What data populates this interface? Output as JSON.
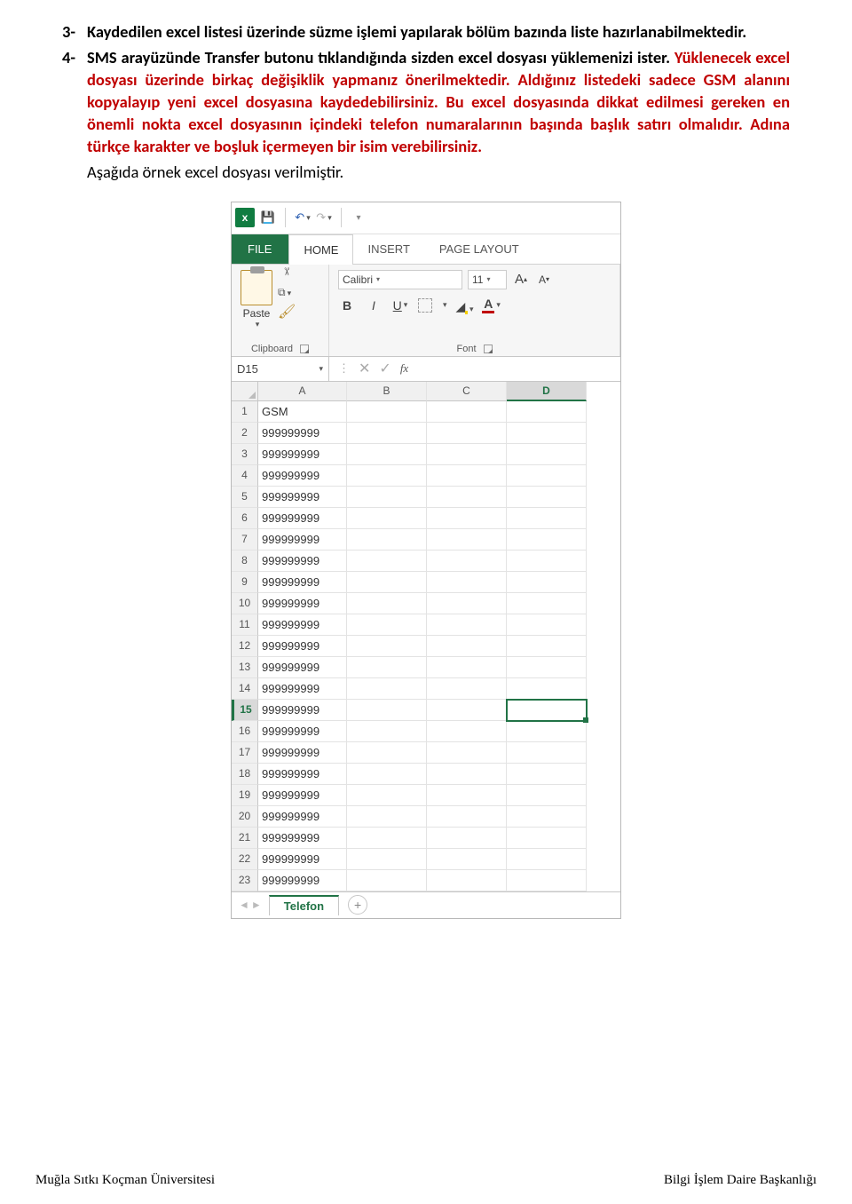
{
  "doc": {
    "item3_num": "3-",
    "item3_text": "Kaydedilen excel listesi üzerinde süzme işlemi yapılarak bölüm bazında liste hazırlanabilmektedir.",
    "item4_num": "4-",
    "item4_lead": "SMS arayüzünde Transfer butonu tıklandığında sizden excel dosyası yüklemenizi ister. ",
    "item4_red1": "Yüklenecek excel dosyası üzerinde birkaç değişiklik yapmanız önerilmektedir. Aldığınız listedeki sadece GSM alanını kopyalayıp yeni excel dosyasına kaydedebilirsiniz. Bu excel dosyasında dikkat edilmesi gereken en önemli nokta excel dosyasının içindeki telefon numaralarının başında başlık satırı olmalıdır. Adına türkçe karakter ve boşluk içermeyen bir isim verebilirsiniz.",
    "item4_tail": "Aşağıda  örnek excel dosyası verilmiştir."
  },
  "excel": {
    "tabs": {
      "file": "FILE",
      "home": "HOME",
      "insert": "INSERT",
      "pagelayout": "PAGE LAYOUT"
    },
    "paste_label": "Paste",
    "clipboard_label": "Clipboard",
    "font_label": "Font",
    "font_name": "Calibri",
    "font_size": "11",
    "namebox": "D15",
    "fx": "fx",
    "columns": [
      "A",
      "B",
      "C",
      "D"
    ],
    "rows": [
      {
        "n": "1",
        "a": "GSM"
      },
      {
        "n": "2",
        "a": "999999999"
      },
      {
        "n": "3",
        "a": "999999999"
      },
      {
        "n": "4",
        "a": "999999999"
      },
      {
        "n": "5",
        "a": "999999999"
      },
      {
        "n": "6",
        "a": "999999999"
      },
      {
        "n": "7",
        "a": "999999999"
      },
      {
        "n": "8",
        "a": "999999999"
      },
      {
        "n": "9",
        "a": "999999999"
      },
      {
        "n": "10",
        "a": "999999999"
      },
      {
        "n": "11",
        "a": "999999999"
      },
      {
        "n": "12",
        "a": "999999999"
      },
      {
        "n": "13",
        "a": "999999999"
      },
      {
        "n": "14",
        "a": "999999999"
      },
      {
        "n": "15",
        "a": "999999999"
      },
      {
        "n": "16",
        "a": "999999999"
      },
      {
        "n": "17",
        "a": "999999999"
      },
      {
        "n": "18",
        "a": "999999999"
      },
      {
        "n": "19",
        "a": "999999999"
      },
      {
        "n": "20",
        "a": "999999999"
      },
      {
        "n": "21",
        "a": "999999999"
      },
      {
        "n": "22",
        "a": "999999999"
      },
      {
        "n": "23",
        "a": "999999999"
      }
    ],
    "sheet_name": "Telefon",
    "active_cell": {
      "row": 15,
      "col": "D"
    }
  },
  "footer": {
    "left": "Muğla Sıtkı Koçman Üniversitesi",
    "right": "Bilgi İşlem Daire Başkanlığı"
  }
}
